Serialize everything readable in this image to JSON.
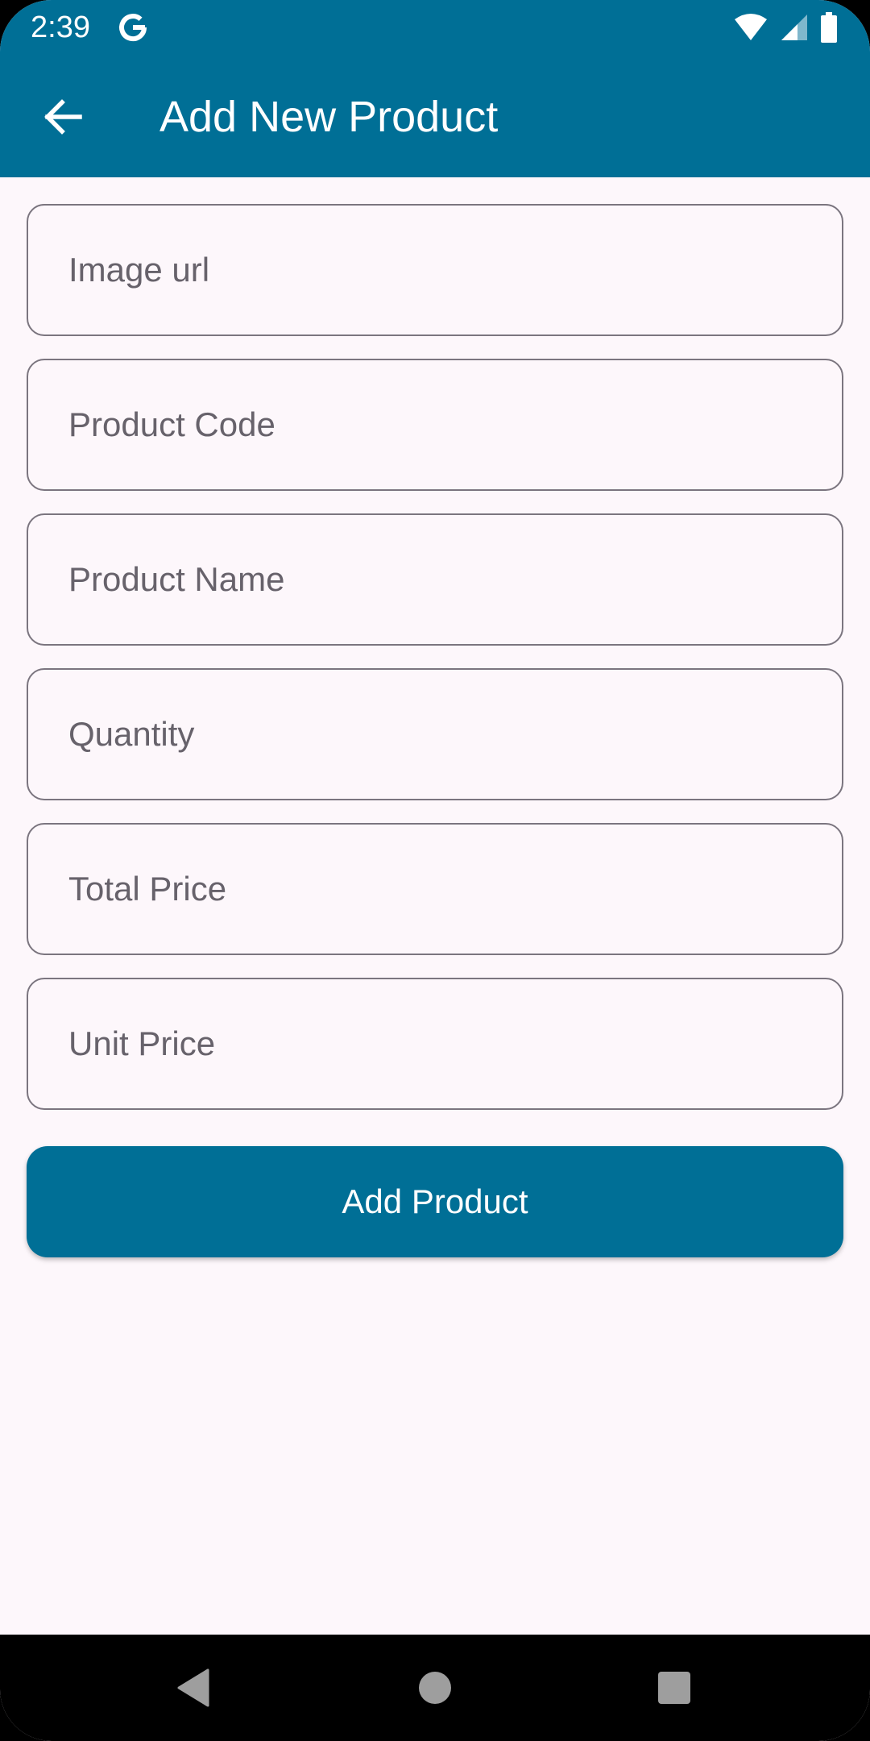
{
  "status_bar": {
    "time": "2:39",
    "icons": [
      "google-g-icon",
      "wifi-icon",
      "cellular-signal-icon",
      "battery-icon"
    ]
  },
  "app_bar": {
    "title": "Add New Product",
    "back_icon": "arrow-back-icon"
  },
  "form": {
    "fields": [
      {
        "name": "image-url-input",
        "placeholder": "Image url",
        "value": ""
      },
      {
        "name": "product-code-input",
        "placeholder": "Product Code",
        "value": ""
      },
      {
        "name": "product-name-input",
        "placeholder": "Product Name",
        "value": ""
      },
      {
        "name": "quantity-input",
        "placeholder": "Quantity",
        "value": ""
      },
      {
        "name": "total-price-input",
        "placeholder": "Total Price",
        "value": ""
      },
      {
        "name": "unit-price-input",
        "placeholder": "Unit Price",
        "value": ""
      }
    ],
    "submit_label": "Add Product"
  },
  "nav_bar": {
    "icons": [
      "nav-back-icon",
      "nav-home-icon",
      "nav-recents-icon"
    ]
  },
  "colors": {
    "primary": "#006f96",
    "background": "#fdf7fb",
    "outline": "#7b757f",
    "placeholder": "#67626b"
  }
}
